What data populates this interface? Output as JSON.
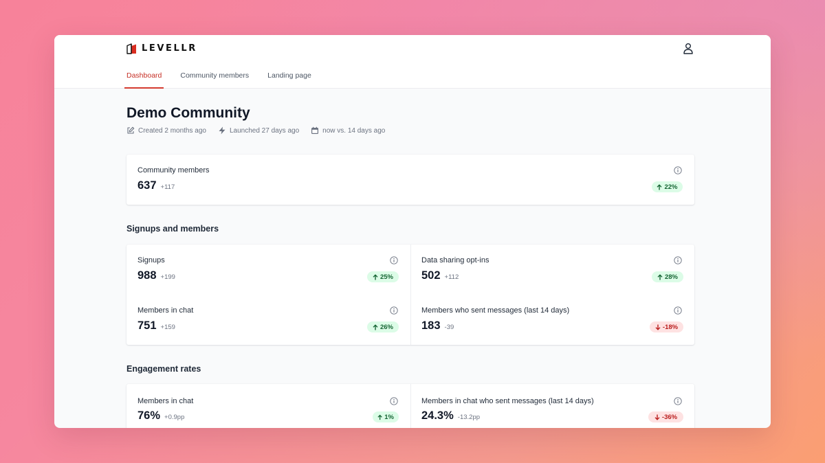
{
  "app": {
    "logo_text": "LEVELLR"
  },
  "nav": {
    "tabs": [
      {
        "label": "Dashboard",
        "active": true
      },
      {
        "label": "Community members",
        "active": false
      },
      {
        "label": "Landing page",
        "active": false
      }
    ]
  },
  "header": {
    "title": "Demo Community",
    "meta": [
      {
        "icon": "edit-icon",
        "text": "Created 2 months ago"
      },
      {
        "icon": "bolt-icon",
        "text": "Launched 27 days ago"
      },
      {
        "icon": "calendar-icon",
        "text": "now vs. 14 days ago"
      }
    ]
  },
  "community_card": {
    "label": "Community members",
    "value": "637",
    "delta": "+117",
    "change": "22%",
    "direction": "up"
  },
  "signups_section": {
    "title": "Signups and members",
    "stats": [
      {
        "label": "Signups",
        "value": "988",
        "delta": "+199",
        "change": "25%",
        "direction": "up"
      },
      {
        "label": "Data sharing opt-ins",
        "value": "502",
        "delta": "+112",
        "change": "28%",
        "direction": "up"
      },
      {
        "label": "Members in chat",
        "value": "751",
        "delta": "+159",
        "change": "26%",
        "direction": "up"
      },
      {
        "label": "Members who sent messages (last 14 days)",
        "value": "183",
        "delta": "-39",
        "change": "-18%",
        "direction": "down"
      }
    ]
  },
  "engagement_section": {
    "title": "Engagement rates",
    "stats": [
      {
        "label": "Members in chat",
        "value": "76%",
        "delta": "+0.9pp",
        "change": "1%",
        "direction": "up"
      },
      {
        "label": "Members in chat who sent messages (last 14 days)",
        "value": "24.3%",
        "delta": "-13.2pp",
        "change": "-36%",
        "direction": "down"
      }
    ]
  },
  "colors": {
    "accent": "#d53b2f",
    "up_bg": "#dcfce7",
    "up_fg": "#166534",
    "down_bg": "#fee2e2",
    "down_fg": "#b91c1c"
  }
}
